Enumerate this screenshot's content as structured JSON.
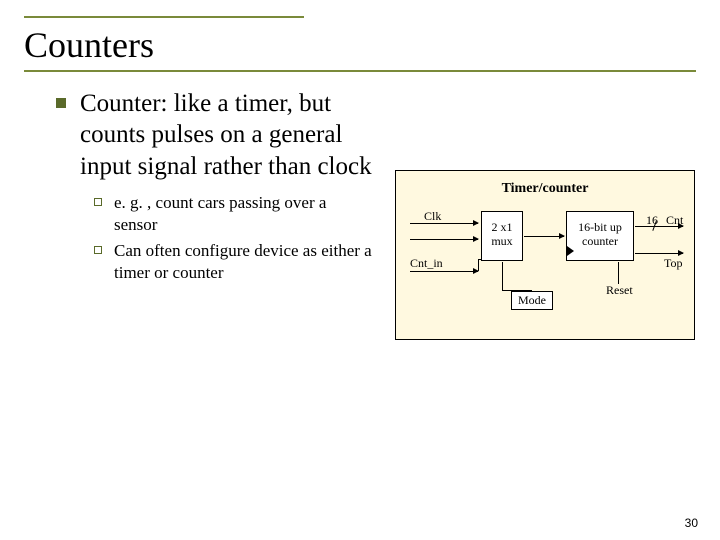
{
  "title": "Counters",
  "bullet_main": "Counter: like a timer, but counts pulses on a general input signal rather than clock",
  "sub": [
    "e. g. , count cars passing over a sensor",
    "Can often configure device as either a timer or counter"
  ],
  "diagram": {
    "title": "Timer/counter",
    "clk": "Clk",
    "cnt_in": "Cnt_in",
    "mux_l1": "2 x1",
    "mux_l2": "mux",
    "counter_l1": "16-bit up",
    "counter_l2": "counter",
    "bus_width": "16",
    "cnt_out": "Cnt",
    "top": "Top",
    "mode": "Mode",
    "reset": "Reset"
  },
  "page_number": "30"
}
